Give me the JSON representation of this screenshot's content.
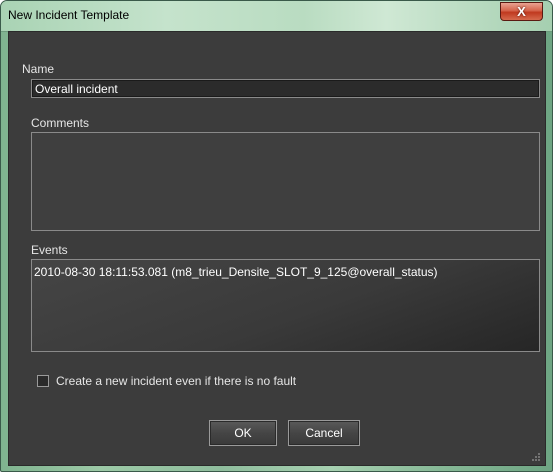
{
  "window": {
    "title": "New Incident Template",
    "close_glyph": "X"
  },
  "form": {
    "name_label": "Name",
    "name_value": "Overall incident",
    "comments_label": "Comments",
    "comments_value": "",
    "events_label": "Events",
    "events": [
      "2010-08-30 18:11:53.081 (m8_trieu_Densite_SLOT_9_125@overall_status)"
    ],
    "no_fault_checkbox_label": "Create a new incident even if there is no fault",
    "no_fault_checked": false
  },
  "buttons": {
    "ok_label": "OK",
    "cancel_label": "Cancel"
  },
  "icons": {
    "close": "close-icon"
  },
  "colors": {
    "dialog_bg": "#3c3c3c",
    "titlebar": "#b9dcc1",
    "close_button": "#c0391f",
    "text": "#e6e6e6"
  }
}
